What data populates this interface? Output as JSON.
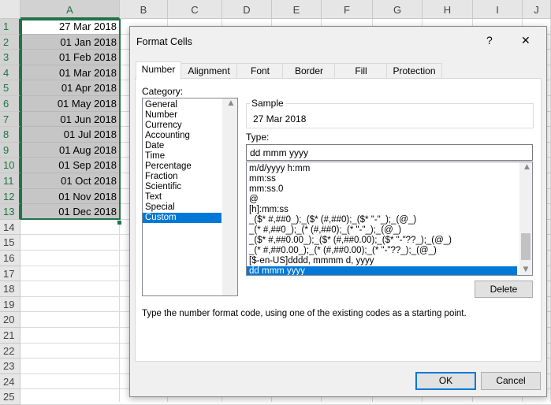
{
  "spreadsheet": {
    "columns": [
      "A",
      "B",
      "C",
      "D",
      "E",
      "F",
      "G",
      "H",
      "I",
      "J"
    ],
    "rows": [
      "1",
      "2",
      "3",
      "4",
      "5",
      "6",
      "7",
      "8",
      "9",
      "10",
      "11",
      "12",
      "13",
      "14",
      "15",
      "16",
      "17",
      "18",
      "19",
      "20",
      "21",
      "22",
      "23",
      "24",
      "25"
    ],
    "cells_A": [
      "27 Mar 2018",
      "01 Jan 2018",
      "01 Feb 2018",
      "01 Mar 2018",
      "01 Apr 2018",
      "01 May 2018",
      "01 Jun 2018",
      "01 Jul 2018",
      "01 Aug 2018",
      "01 Sep 2018",
      "01 Oct 2018",
      "01 Nov 2018",
      "01 Dec 2018"
    ],
    "accent": "#217346"
  },
  "dialog": {
    "title": "Format Cells",
    "help": "?",
    "close": "✕",
    "tabs": [
      "Number",
      "Alignment",
      "Font",
      "Border",
      "Fill",
      "Protection"
    ],
    "active_tab": "Number",
    "category_label": "Category:",
    "categories": [
      "General",
      "Number",
      "Currency",
      "Accounting",
      "Date",
      "Time",
      "Percentage",
      "Fraction",
      "Scientific",
      "Text",
      "Special",
      "Custom"
    ],
    "selected_category": "Custom",
    "sample_label": "Sample",
    "sample_value": "27 Mar 2018",
    "type_label": "Type:",
    "type_value": "dd mmm yyyy",
    "type_list": [
      "m/d/yyyy h:mm",
      "mm:ss",
      "mm:ss.0",
      "@",
      "[h]:mm:ss",
      "_($* #,##0_);_($* (#,##0);_($* \"-\"_);_(@_)",
      "_(* #,##0_);_(* (#,##0);_(* \"-\"_);_(@_)",
      "_($* #,##0.00_);_($* (#,##0.00);_($* \"-\"??_);_(@_)",
      "_(* #,##0.00_);_(* (#,##0.00);_(* \"-\"??_);_(@_)",
      "[$-en-US]dddd, mmmm d, yyyy",
      "dd mmm yyyy"
    ],
    "selected_type": "dd mmm yyyy",
    "delete_label": "Delete",
    "description": "Type the number format code, using one of the existing codes as a starting point.",
    "ok_label": "OK",
    "cancel_label": "Cancel",
    "selection_color": "#0078d7"
  }
}
